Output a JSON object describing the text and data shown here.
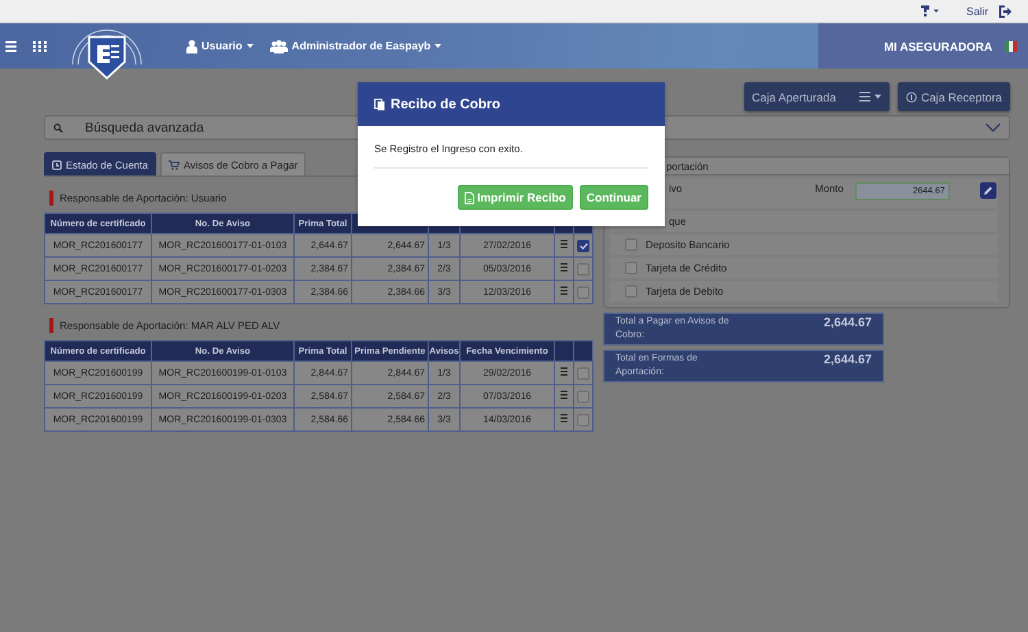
{
  "top_bar": {
    "logout": "Salir"
  },
  "header": {
    "menu_items": [
      {
        "label": "Usuario",
        "kind": "user"
      },
      {
        "label": "Administrador de Easpayb",
        "kind": "users"
      }
    ],
    "brand": "MI ASEGURADORA"
  },
  "actions": [
    {
      "label": "Caja Aperturada",
      "kind": "menu"
    },
    {
      "label": "Caja Receptora",
      "kind": "info"
    }
  ],
  "search": {
    "title": "Búsqueda avanzada"
  },
  "tabs": [
    {
      "label": "Estado de Cuenta",
      "selected": true,
      "kind": "clock"
    },
    {
      "label": "Avisos de Cobro a Pagar",
      "selected": false,
      "kind": "cart"
    }
  ],
  "groups": [
    {
      "responsible": "Responsable de Aportación: Usuario",
      "columns": [
        "Número de certificado",
        "No. De Aviso",
        "Prima Total"
      ],
      "rows": [
        {
          "cells": [
            "MOR_RC201600177",
            "MOR_RC201600177-01-0103",
            "2,644.67",
            "2,644.67",
            "1/3",
            "27/02/2016"
          ],
          "checked": true
        },
        {
          "cells": [
            "MOR_RC201600177",
            "MOR_RC201600177-01-0203",
            "2,384.67",
            "2,384.67",
            "2/3",
            "05/03/2016"
          ],
          "checked": false
        },
        {
          "cells": [
            "MOR_RC201600177",
            "MOR_RC201600177-01-0303",
            "2,384.66",
            "2,384.66",
            "3/3",
            "12/03/2016"
          ],
          "checked": false
        }
      ]
    },
    {
      "responsible": "Responsable de Aportación: MAR ALV PED ALV",
      "columns": [
        "Número de certificado",
        "No. De Aviso",
        "Prima Total",
        "Prima Pendiente",
        "Avisos",
        "Fecha Vencimiento"
      ],
      "rows": [
        {
          "cells": [
            "MOR_RC201600199",
            "MOR_RC201600199-01-0103",
            "2,844.67",
            "2,844.67",
            "1/3",
            "29/02/2016"
          ],
          "checked": false
        },
        {
          "cells": [
            "MOR_RC201600199",
            "MOR_RC201600199-01-0203",
            "2,584.67",
            "2,584.67",
            "2/3",
            "07/03/2016"
          ],
          "checked": false
        },
        {
          "cells": [
            "MOR_RC201600199",
            "MOR_RC201600199-01-0303",
            "2,584.66",
            "2,584.66",
            "3/3",
            "14/03/2016"
          ],
          "checked": false
        }
      ]
    }
  ],
  "payment": {
    "title": "portación",
    "methods": [
      {
        "kind": "amount",
        "label": "ivo",
        "amount_label": "Monto",
        "amount": "2644.67"
      },
      {
        "kind": "plain",
        "label": "que"
      },
      {
        "kind": "check",
        "label": "Deposito Bancario",
        "checked": false
      },
      {
        "kind": "check",
        "label": "Tarjeta de Crédito",
        "checked": false
      },
      {
        "kind": "check",
        "label": "Tarjeta de Debito",
        "checked": false
      }
    ]
  },
  "totals": [
    {
      "label": "Total a Pagar en Avisos de Cobro:",
      "value": "2,644.67"
    },
    {
      "label": "Total en Formas de Aportación:",
      "value": "2,644.67"
    }
  ],
  "modal": {
    "title": "Recibo de Cobro",
    "message": "Se Registro el Ingreso con exito.",
    "buttons": [
      {
        "label": "Imprimir Recibo",
        "kind": "print"
      },
      {
        "label": "Continuar",
        "kind": "plain"
      }
    ]
  }
}
